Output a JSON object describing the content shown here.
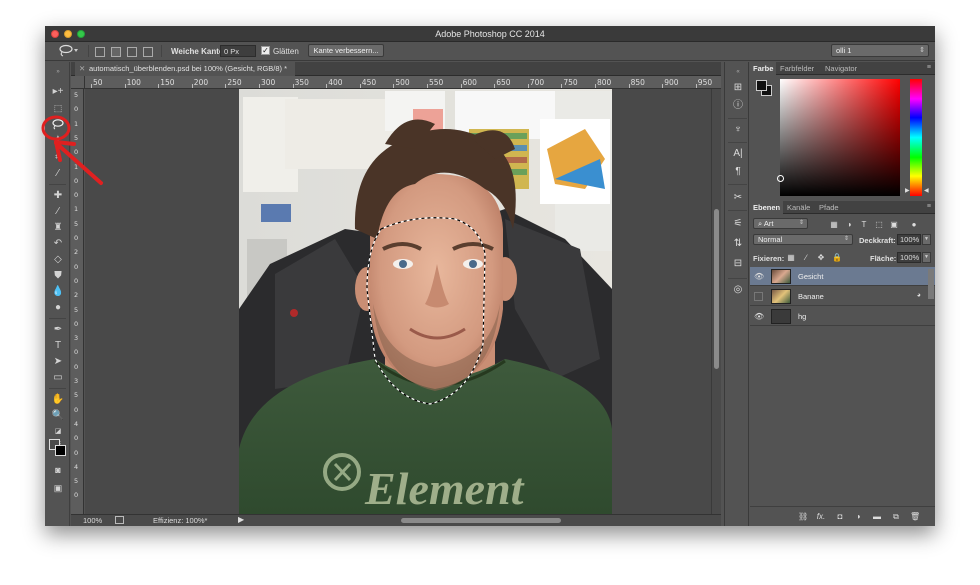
{
  "window": {
    "title": "Adobe Photoshop CC 2014"
  },
  "options_bar": {
    "feather_label": "Weiche Kante:",
    "feather_value": "0 Px",
    "smooth_label": "Glätten",
    "smooth_checked": true,
    "refine_edge_label": "Kante verbessern...",
    "workspace_value": "olli 1"
  },
  "document": {
    "tab_title": "automatisch_überblenden.psd bei 100% (Gesicht, RGB/8) *",
    "ruler_h": [
      "50",
      "100",
      "150",
      "200",
      "250",
      "300",
      "350",
      "400",
      "450",
      "500",
      "550",
      "600",
      "650",
      "700",
      "750",
      "800",
      "850",
      "900",
      "950"
    ],
    "ruler_v": [
      "5",
      "0",
      "1",
      "5",
      "0",
      "1",
      "0",
      "0",
      "1",
      "5",
      "0",
      "2",
      "0",
      "0",
      "2",
      "5",
      "0",
      "3",
      "0",
      "0",
      "3",
      "5",
      "0",
      "4",
      "0",
      "0",
      "4",
      "5",
      "0"
    ]
  },
  "status_bar": {
    "zoom": "100%",
    "efficiency": "Effizienz: 100%*"
  },
  "color_panel": {
    "tabs": [
      "Farbe",
      "Farbfelder",
      "Navigator"
    ],
    "active_tab": "Farbe",
    "hue_color": "#ff0000"
  },
  "layers_panel": {
    "tabs": [
      "Ebenen",
      "Kanäle",
      "Pfade"
    ],
    "active_tab": "Ebenen",
    "filter_kind": "Art",
    "blend_mode": "Normal",
    "opacity_label": "Deckkraft:",
    "opacity_value": "100%",
    "lock_label": "Fixieren:",
    "fill_label": "Fläche:",
    "fill_value": "100%",
    "layers": [
      {
        "name": "Gesicht",
        "visible": true,
        "selected": true,
        "thumb": "photo"
      },
      {
        "name": "Banane",
        "visible": false,
        "selected": false,
        "thumb": "photo"
      },
      {
        "name": "hg",
        "visible": true,
        "selected": false,
        "thumb": "dark"
      }
    ],
    "footer_icons": [
      "link-icon",
      "fx-icon",
      "mask-icon",
      "adjustment-icon",
      "folder-icon",
      "new-layer-icon",
      "trash-icon"
    ],
    "footer_fx_label": "fx."
  },
  "annotation": {
    "color": "#e02020"
  }
}
